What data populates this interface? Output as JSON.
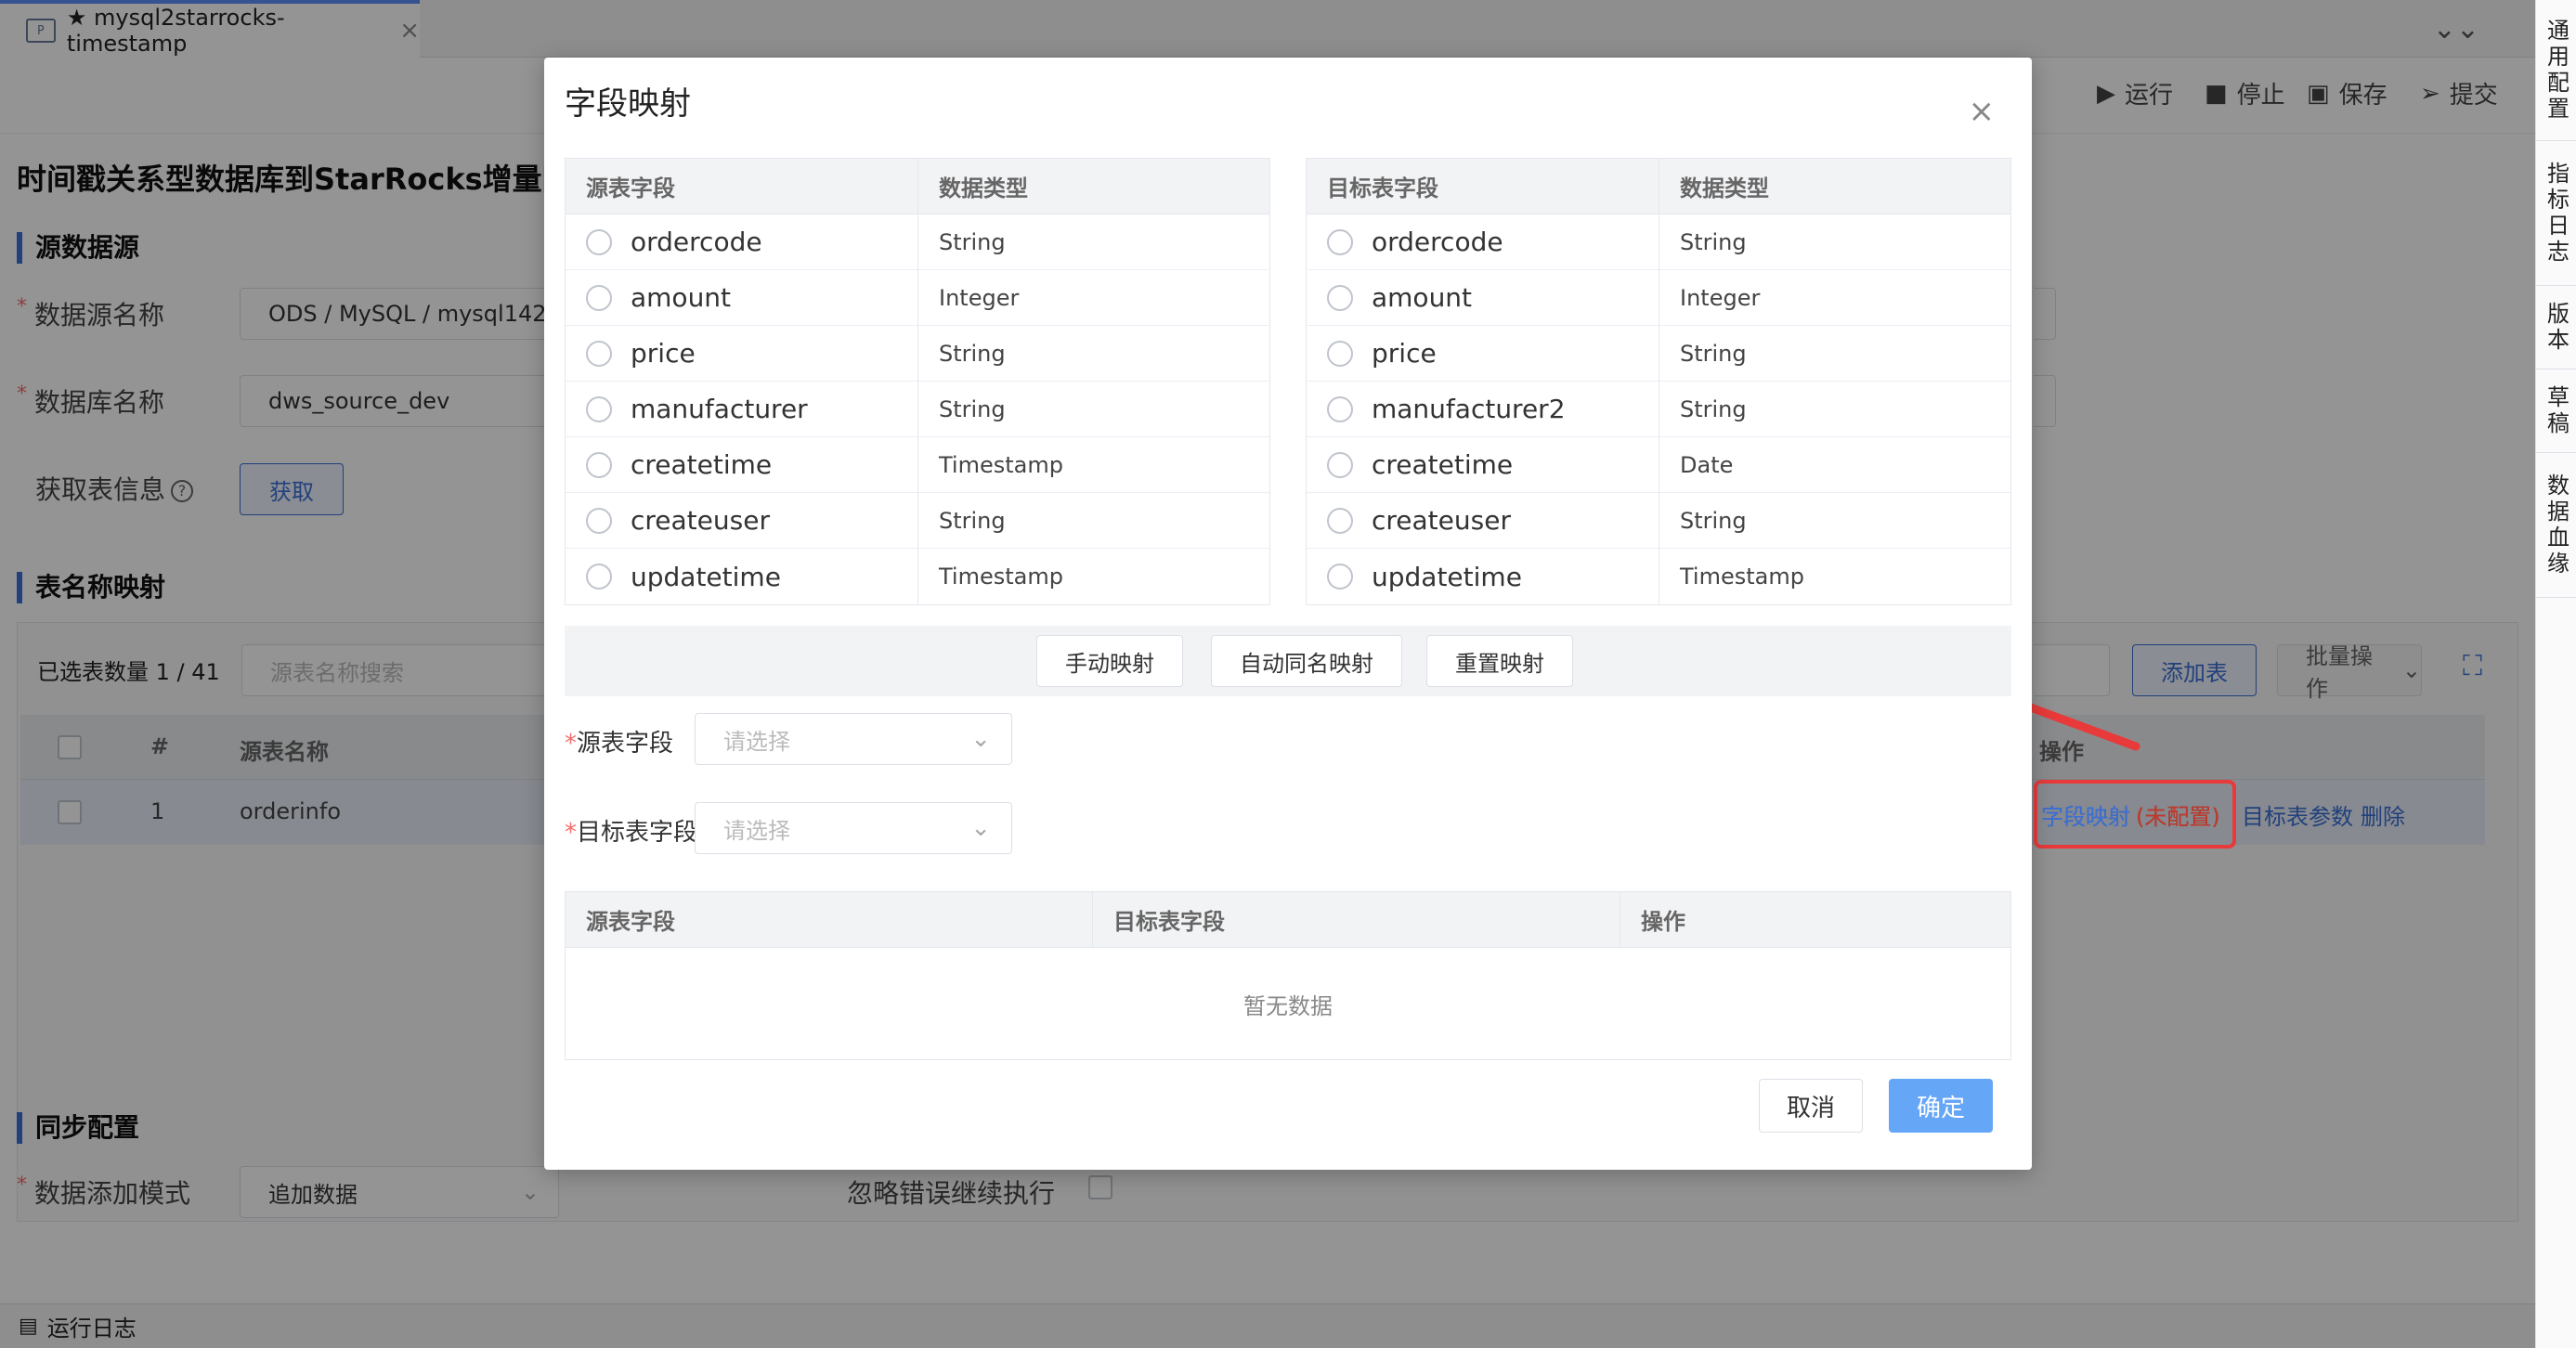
{
  "tab": {
    "icon": "P",
    "title": "★ mysql2starrocks-timestamp",
    "close": "×"
  },
  "collapse_glyph": "⌄⌄",
  "toolbar": {
    "run": "运行",
    "stop": "停止",
    "save": "保存",
    "submit": "提交"
  },
  "side_panel": [
    "通用配置",
    "指标日志",
    "版本",
    "草稿",
    "数据血缘"
  ],
  "page": {
    "title": "时间戳关系型数据库到StarRocks增量同",
    "source_section": "源数据源",
    "datasource_label": "数据源名称",
    "datasource_value": "ODS / MySQL / mysql142",
    "database_label": "数据库名称",
    "database_value": "dws_source_dev",
    "fetch_label": "获取表信息",
    "fetch_button": "获取",
    "table_mapping_section": "表名称映射",
    "selected_count": "已选表数量 1 / 41",
    "search_placeholder": "源表名称搜索",
    "add_table": "添加表",
    "batch_ops": "批量操作",
    "table_headers": {
      "index": "#",
      "source_name": "源表名称",
      "ops": "操作"
    },
    "row": {
      "index": "1",
      "source_name": "orderinfo",
      "field_mapping": "字段映射",
      "unconfigured": "(未配置)",
      "target_params": "目标表参数",
      "delete": "删除"
    },
    "sync_section": "同步配置",
    "add_mode_label": "数据添加模式",
    "add_mode_value": "追加数据",
    "ignore_errors_label": "忽略错误继续执行"
  },
  "statusbar": {
    "label": "运行日志"
  },
  "dialog": {
    "title": "字段映射",
    "close": "×",
    "source_table": {
      "headers": [
        "源表字段",
        "数据类型"
      ],
      "rows": [
        {
          "field": "ordercode",
          "type": "String"
        },
        {
          "field": "amount",
          "type": "Integer"
        },
        {
          "field": "price",
          "type": "String"
        },
        {
          "field": "manufacturer",
          "type": "String"
        },
        {
          "field": "createtime",
          "type": "Timestamp"
        },
        {
          "field": "createuser",
          "type": "String"
        },
        {
          "field": "updatetime",
          "type": "Timestamp"
        }
      ]
    },
    "target_table": {
      "headers": [
        "目标表字段",
        "数据类型"
      ],
      "rows": [
        {
          "field": "ordercode",
          "type": "String"
        },
        {
          "field": "amount",
          "type": "Integer"
        },
        {
          "field": "price",
          "type": "String"
        },
        {
          "field": "manufacturer2",
          "type": "String"
        },
        {
          "field": "createtime",
          "type": "Date"
        },
        {
          "field": "createuser",
          "type": "String"
        },
        {
          "field": "updatetime",
          "type": "Timestamp"
        }
      ]
    },
    "buttons": {
      "manual": "手动映射",
      "auto": "自动同名映射",
      "reset": "重置映射",
      "cancel": "取消",
      "ok": "确定"
    },
    "source_select_label": "源表字段",
    "target_select_label": "目标表字段",
    "select_placeholder": "请选择",
    "mapping_table": {
      "headers": [
        "源表字段",
        "目标表字段",
        "操作"
      ],
      "empty": "暂无数据"
    }
  },
  "colors": {
    "accent": "#3b6fd6",
    "primary_btn": "#66a6f7",
    "highlight": "#e83a3a"
  }
}
